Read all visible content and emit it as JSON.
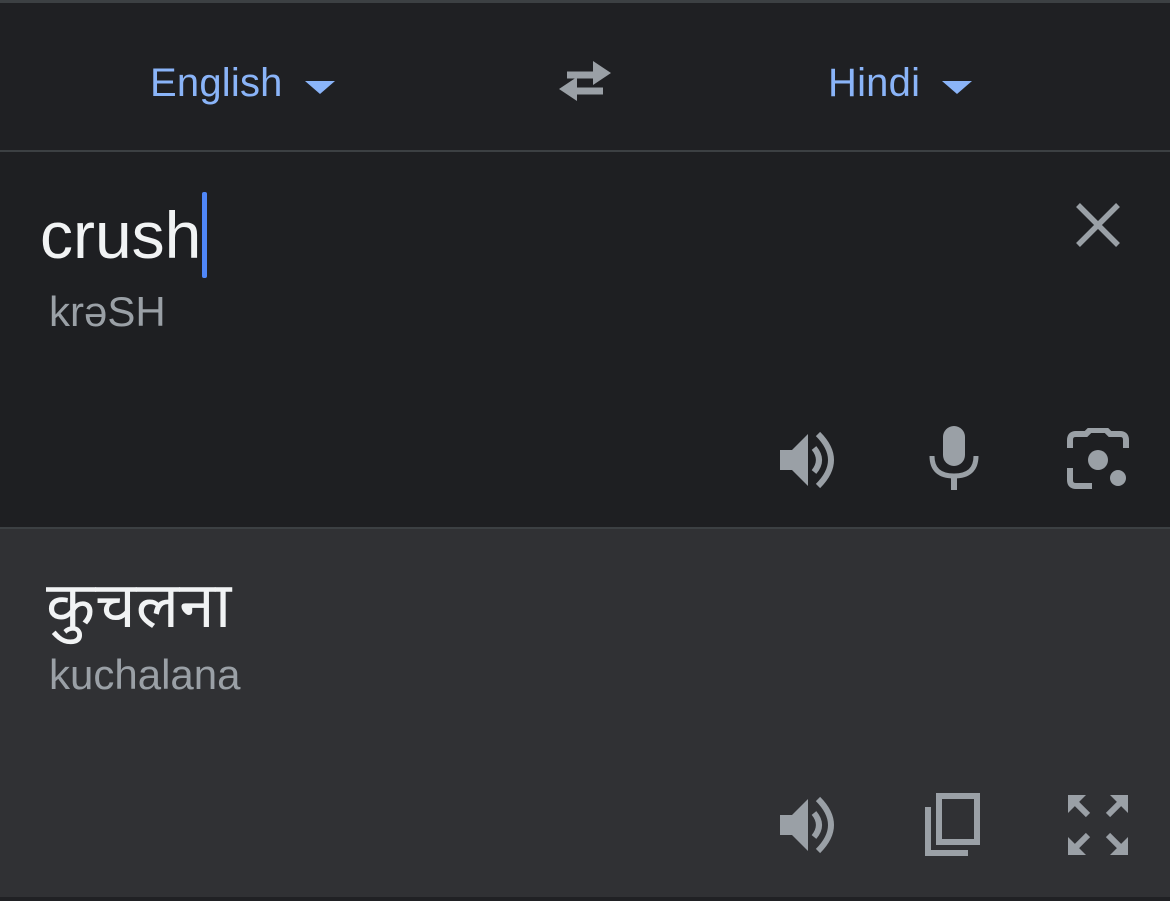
{
  "language_bar": {
    "source_language": "English",
    "target_language": "Hindi",
    "swap_icon": "swap-arrows-icon"
  },
  "input": {
    "text": "crush",
    "transliteration": "krəSH",
    "clear_icon": "close-icon",
    "actions": [
      "speaker-icon",
      "microphone-icon",
      "camera-lens-icon"
    ]
  },
  "output": {
    "text": "कुचलना",
    "transliteration": "kuchalana",
    "actions": [
      "speaker-icon",
      "copy-icon",
      "fullscreen-icon"
    ]
  },
  "colors": {
    "accent": "#8ab4f8",
    "cursor": "#4f86f7",
    "background": "#202124",
    "output_background": "#303134",
    "icon": "#9aa0a6"
  }
}
